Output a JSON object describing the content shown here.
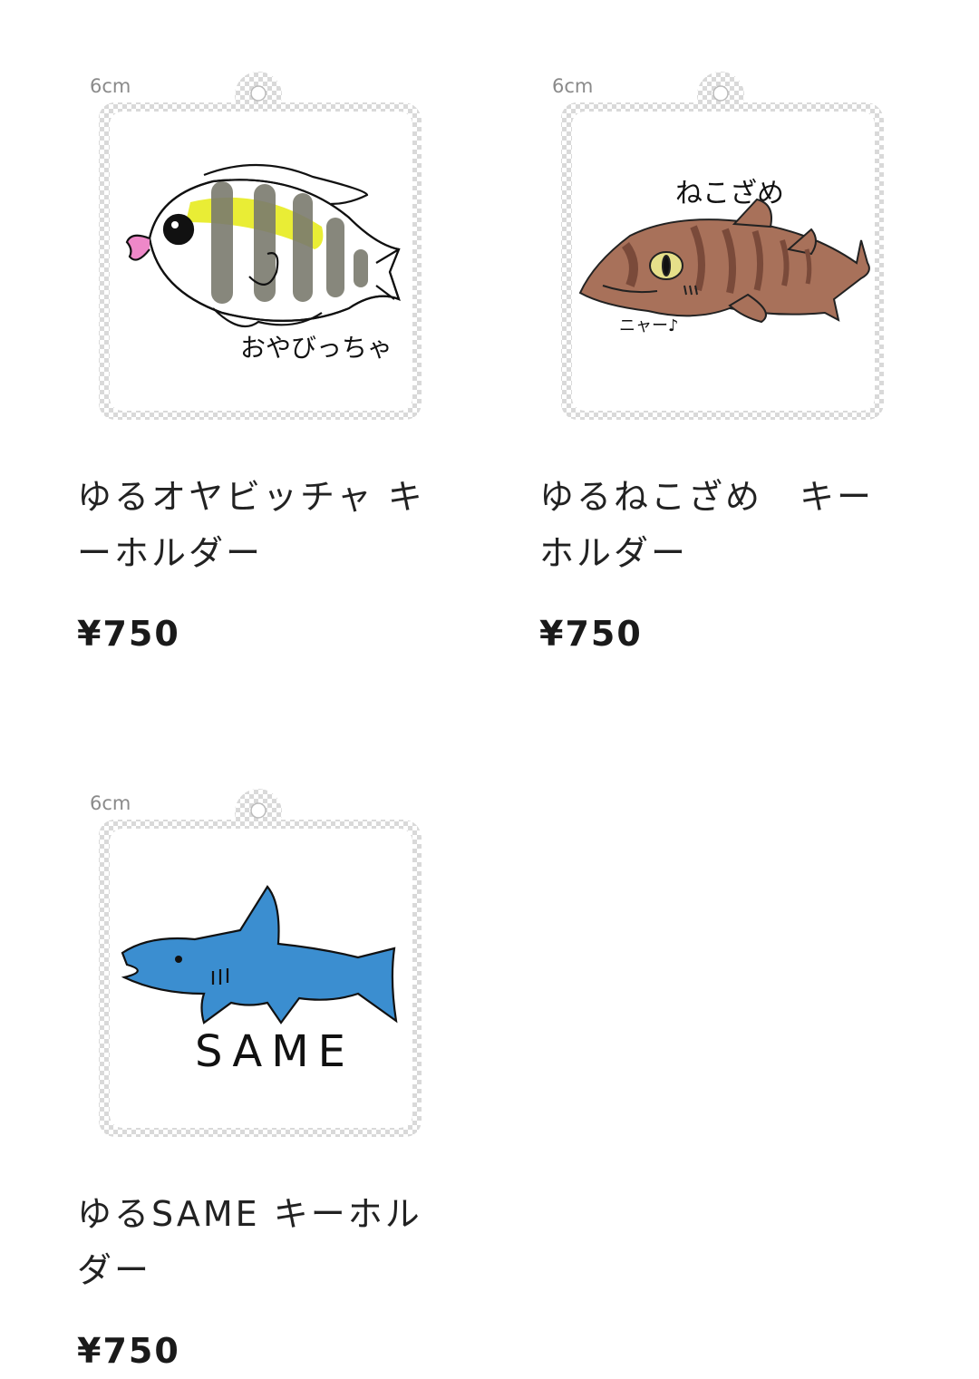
{
  "products": [
    {
      "size_label": "6cm",
      "drawing_caption": "おやびっちゃ",
      "title": "ゆるオヤビッチャ キーホルダー",
      "price": "¥750",
      "colors": {
        "body": "#ffffff",
        "stripes": "#7a7a6e",
        "accent": "#e8ec2a",
        "lips": "#ee88c8"
      }
    },
    {
      "size_label": "6cm",
      "drawing_caption": "ねこざめ",
      "drawing_sound": "ニャー♪",
      "title": "ゆるねこざめ　キーホルダー",
      "price": "¥750",
      "colors": {
        "body": "#a8715a",
        "stripes": "#7a4a3a",
        "eye": "#e6e08a"
      }
    },
    {
      "size_label": "6cm",
      "drawing_caption": "SAME",
      "title": "ゆるSAME キーホルダー",
      "price": "¥750",
      "colors": {
        "body": "#3b8ed0"
      }
    }
  ]
}
